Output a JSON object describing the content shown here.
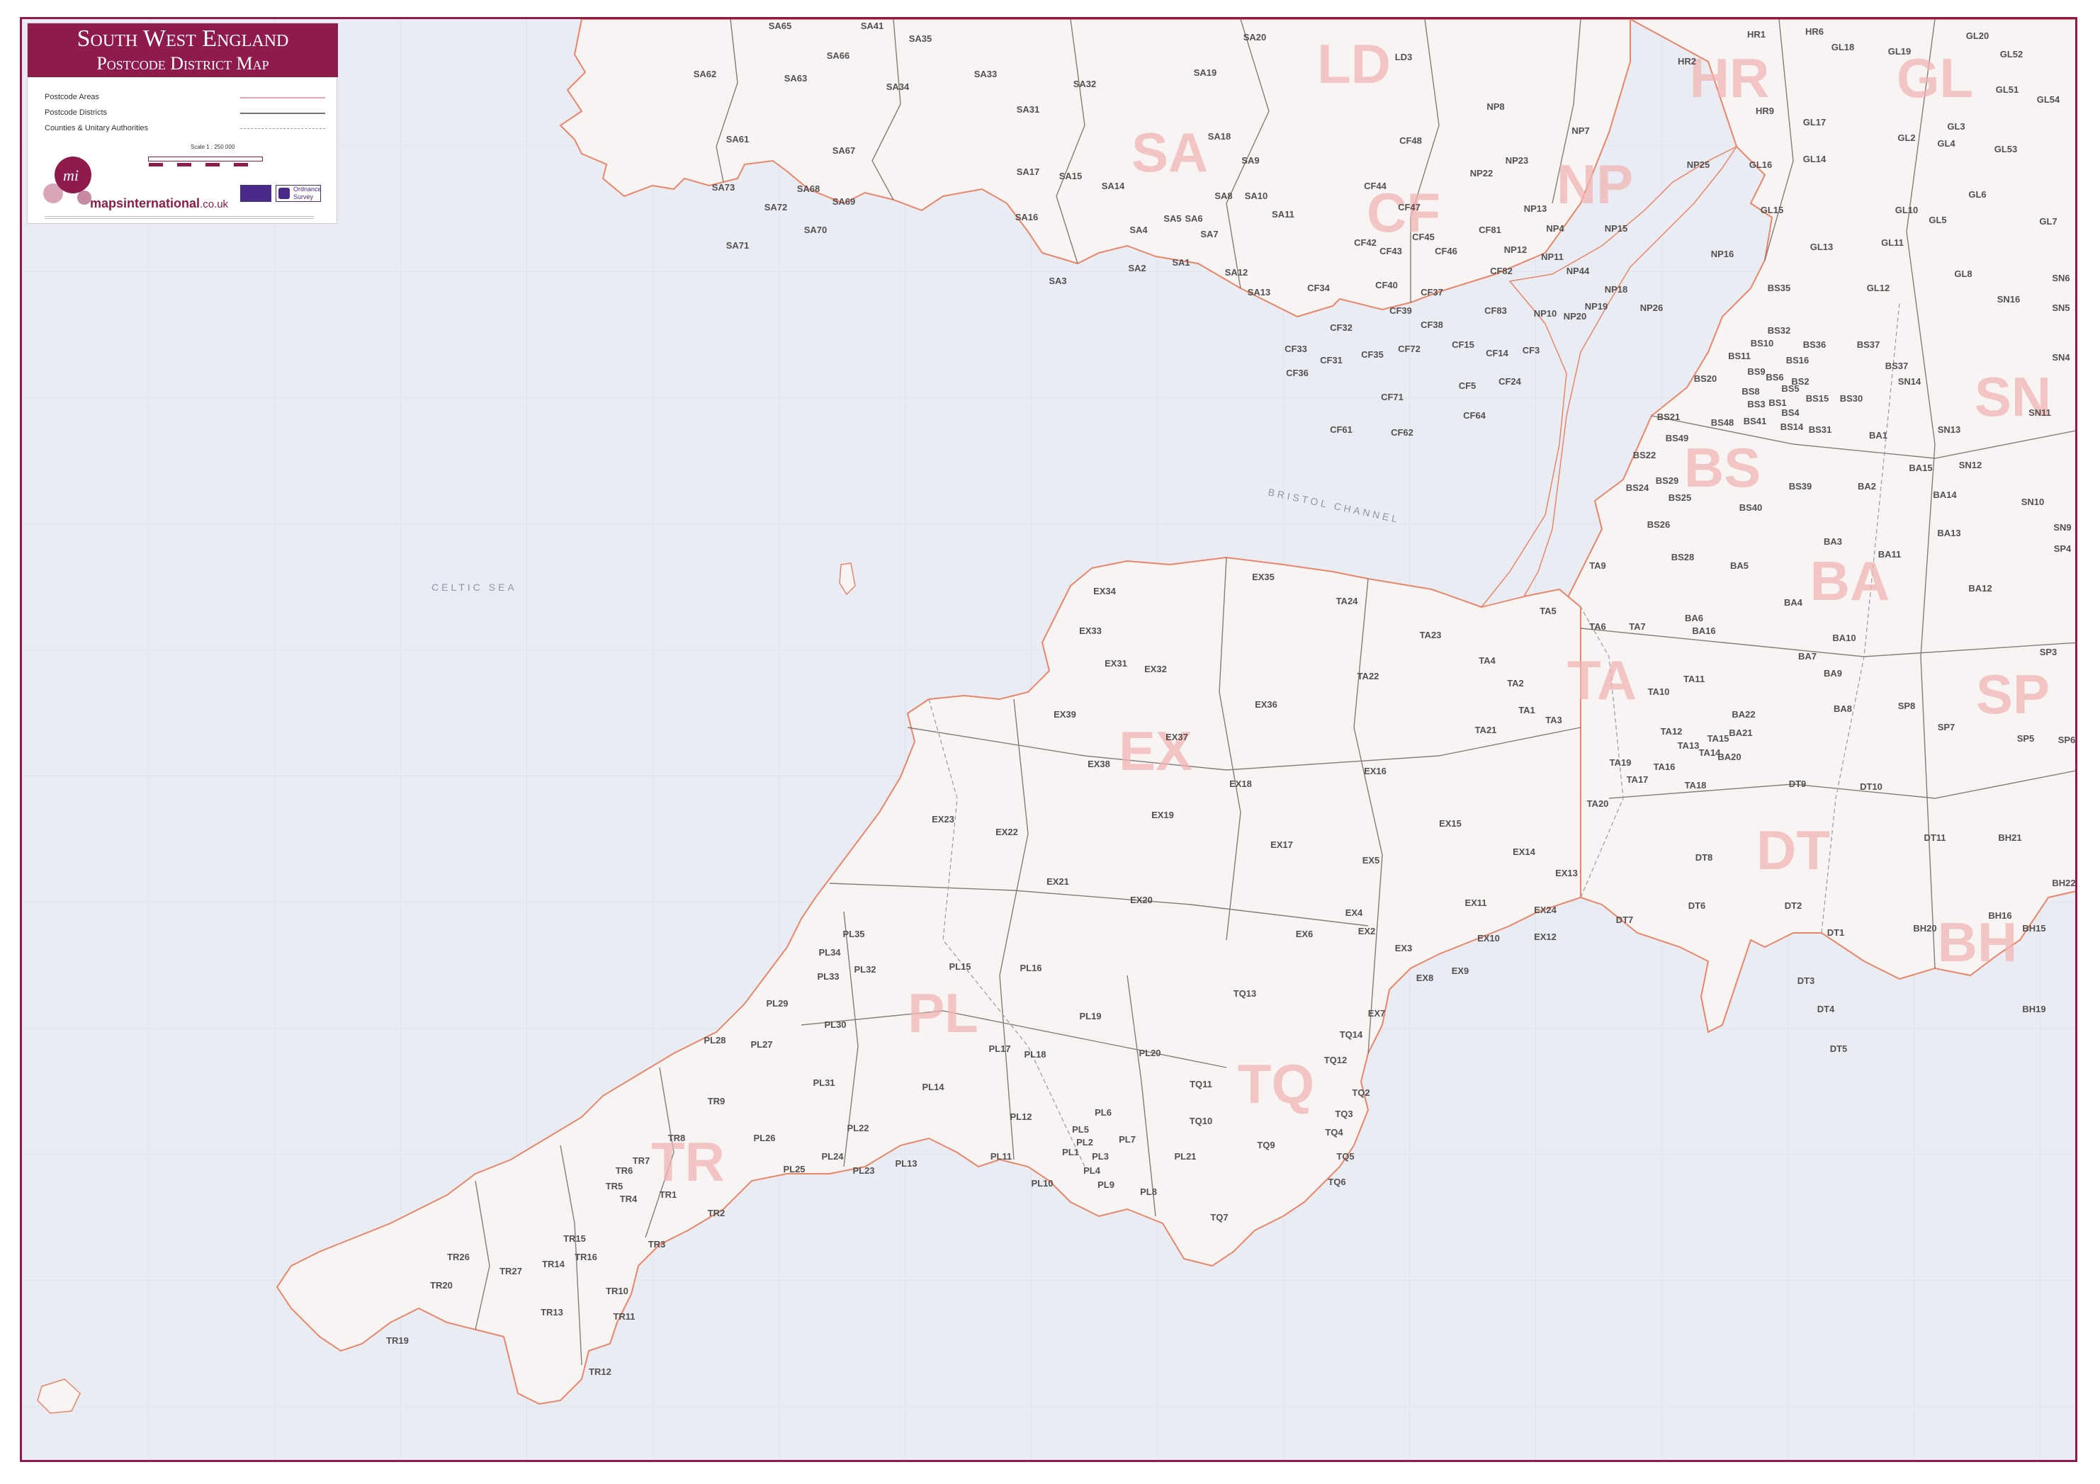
{
  "legend": {
    "title_line1": "South West England",
    "title_line2": "Postcode District Map",
    "items": [
      {
        "label": "Postcode Areas",
        "color": "#f2a1ad"
      },
      {
        "label": "Postcode Districts",
        "color": "#7d6f6c"
      },
      {
        "label": "Counties & Unitary Authorities",
        "color": "#9a9a9a"
      }
    ],
    "scale": "Scale 1 : 250 000",
    "brand": "mapsinternational",
    "brand_suffix": ".co.uk",
    "badge_ordnance": "Ordnance Survey"
  },
  "colors": {
    "brand": "#8e1b4a",
    "sea": "#e9edf3",
    "land": "#f7f4f3",
    "area_boundary": "#e98568",
    "district_boundary": "#6b5d5b"
  },
  "sea_labels": [
    "CELTIC SEA",
    "BRISTOL CHANNEL"
  ],
  "area_labels": [
    "SA",
    "LD",
    "HR",
    "GL",
    "CF",
    "NP",
    "BS",
    "SN",
    "BA",
    "EX",
    "TA",
    "SP",
    "DT",
    "PL",
    "TQ",
    "TR",
    "BH"
  ],
  "district_labels": [
    "SA65",
    "SA41",
    "SA35",
    "SA62",
    "SA63",
    "SA66",
    "SA34",
    "SA33",
    "SA32",
    "SA20",
    "SA19",
    "SA61",
    "SA67",
    "SA31",
    "SA18",
    "SA73",
    "SA68",
    "SA72",
    "SA69",
    "SA70",
    "SA71",
    "SA17",
    "SA15",
    "SA14",
    "SA9",
    "SA10",
    "SA8",
    "SA11",
    "SA16",
    "SA4",
    "SA5",
    "SA6",
    "SA7",
    "SA2",
    "SA1",
    "SA12",
    "SA3",
    "SA13",
    "LD3",
    "CF48",
    "NP8",
    "NP7",
    "NP22",
    "NP23",
    "CF44",
    "NP13",
    "NP4",
    "NP15",
    "CF47",
    "CF42",
    "CF43",
    "CF45",
    "CF81",
    "NP12",
    "NP11",
    "NP44",
    "NP18",
    "CF46",
    "CF82",
    "CF34",
    "CF40",
    "CF37",
    "CF39",
    "CF83",
    "NP10",
    "NP20",
    "NP19",
    "NP26",
    "CF32",
    "CF38",
    "CF33",
    "CF31",
    "CF35",
    "CF72",
    "CF15",
    "CF14",
    "CF3",
    "CF36",
    "CF5",
    "CF24",
    "CF71",
    "CF64",
    "CF61",
    "CF62",
    "HR1",
    "HR6",
    "HR2",
    "HR9",
    "GL18",
    "GL19",
    "GL20",
    "GL52",
    "GL51",
    "GL54",
    "GL17",
    "GL3",
    "GL2",
    "GL4",
    "GL53",
    "GL14",
    "GL16",
    "NP25",
    "GL6",
    "GL15",
    "NP16",
    "GL10",
    "GL5",
    "GL7",
    "GL13",
    "GL11",
    "GL8",
    "GL12",
    "SN6",
    "SN16",
    "SN5",
    "SN4",
    "BS35",
    "BS32",
    "BS10",
    "BS36",
    "BS11",
    "BS16",
    "BS20",
    "BS9",
    "BS6",
    "BS2",
    "BS5",
    "BS8",
    "BS1",
    "BS15",
    "BS3",
    "BS4",
    "BS30",
    "BS41",
    "BS14",
    "BS31",
    "BS21",
    "BS48",
    "BS49",
    "BS22",
    "BS29",
    "BS24",
    "BS25",
    "BS40",
    "BS39",
    "BS26",
    "BS37",
    "BS28",
    "BS37",
    "SN14",
    "SN13",
    "SN11",
    "SN12",
    "SN10",
    "SN9",
    "BA1",
    "BA15",
    "BA2",
    "BA14",
    "BA3",
    "BA13",
    "BA11",
    "BA12",
    "BA5",
    "BA4",
    "BA6",
    "BA10",
    "BA16",
    "BA7",
    "BA9",
    "BA8",
    "BA22",
    "BA21",
    "BA20",
    "SP3",
    "SP8",
    "SP7",
    "SP5",
    "SP6",
    "SP4",
    "TA9",
    "TA7",
    "TA6",
    "TA5",
    "TA24",
    "TA23",
    "TA4",
    "TA22",
    "TA2",
    "TA1",
    "TA3",
    "TA21",
    "TA10",
    "TA11",
    "TA12",
    "TA13",
    "TA14",
    "TA19",
    "TA17",
    "TA18",
    "TA16",
    "TA20",
    "TA15",
    "EX34",
    "EX35",
    "EX33",
    "EX31",
    "EX32",
    "EX36",
    "EX39",
    "EX37",
    "EX38",
    "EX18",
    "EX19",
    "EX16",
    "EX15",
    "EX17",
    "EX23",
    "EX22",
    "EX21",
    "EX20",
    "EX14",
    "EX13",
    "EX5",
    "EX11",
    "EX24",
    "EX4",
    "EX2",
    "EX3",
    "EX10",
    "EX12",
    "EX6",
    "EX8",
    "EX9",
    "EX7",
    "DT9",
    "DT10",
    "DT8",
    "DT6",
    "DT7",
    "DT2",
    "DT1",
    "DT3",
    "DT4",
    "DT5",
    "DT11",
    "BH21",
    "BH22",
    "BH16",
    "BH20",
    "BH15",
    "BH19",
    "PL35",
    "PL34",
    "PL33",
    "PL32",
    "PL15",
    "PL16",
    "PL29",
    "PL30",
    "PL28",
    "PL27",
    "PL19",
    "PL17",
    "PL18",
    "PL20",
    "PL31",
    "PL14",
    "PL12",
    "PL6",
    "PL5",
    "PL26",
    "PL22",
    "PL24",
    "PL25",
    "PL23",
    "PL13",
    "PL11",
    "PL1",
    "PL2",
    "PL3",
    "PL4",
    "PL7",
    "PL10",
    "PL9",
    "PL8",
    "PL21",
    "TQ13",
    "TQ14",
    "TQ12",
    "TQ11",
    "TQ2",
    "TQ10",
    "TQ3",
    "TQ4",
    "TQ9",
    "TQ5",
    "TQ6",
    "TQ7",
    "TR9",
    "TR8",
    "TR7",
    "TR6",
    "TR5",
    "TR4",
    "TR1",
    "TR2",
    "TR3",
    "TR15",
    "TR16",
    "TR26",
    "TR20",
    "TR27",
    "TR14",
    "TR10",
    "TR13",
    "TR11",
    "TR19",
    "TR12"
  ]
}
